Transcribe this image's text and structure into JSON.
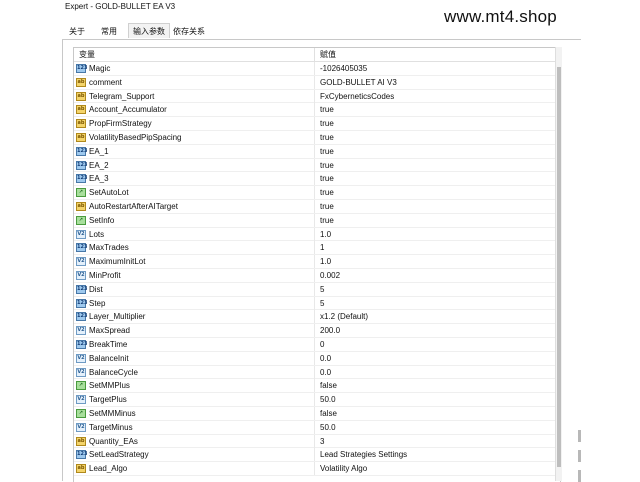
{
  "window": {
    "title": "Expert - GOLD-BULLET EA V3"
  },
  "watermark": "www.mt4.shop",
  "tabs": [
    {
      "label": "关于"
    },
    {
      "label": "常用"
    },
    {
      "label": "输入参数"
    },
    {
      "label": "依存关系"
    }
  ],
  "active_tab": 2,
  "table": {
    "headers": {
      "variable": "变量",
      "value": "赋值"
    },
    "rows": [
      {
        "icon": "ab-string-icon",
        "name": "Magic",
        "value": "-1026405035",
        "type": "n123"
      },
      {
        "icon": "ab-string-icon",
        "name": "comment",
        "value": "GOLD-BULLET AI V3",
        "type": "ab"
      },
      {
        "icon": "ab-string-icon",
        "name": "Telegram_Support",
        "value": "FxCyberneticsCodes",
        "type": "ab"
      },
      {
        "icon": "ab-string-icon",
        "name": "Account_Accumulator",
        "value": "true",
        "type": "ab"
      },
      {
        "icon": "ab-string-icon",
        "name": "PropFirmStrategy",
        "value": "true",
        "type": "ab"
      },
      {
        "icon": "ab-string-icon",
        "name": "VolatilityBasedPipSpacing",
        "value": "true",
        "type": "ab"
      },
      {
        "icon": "integer-icon",
        "name": "EA_1",
        "value": "true",
        "type": "n123"
      },
      {
        "icon": "integer-icon",
        "name": "EA_2",
        "value": "true",
        "type": "n123"
      },
      {
        "icon": "integer-icon",
        "name": "EA_3",
        "value": "true",
        "type": "n123"
      },
      {
        "icon": "graph-icon",
        "name": "SetAutoLot",
        "value": "true",
        "type": "graph"
      },
      {
        "icon": "ab-string-icon",
        "name": "AutoRestartAfterAITarget",
        "value": "true",
        "type": "ab"
      },
      {
        "icon": "graph-icon",
        "name": "SetInfo",
        "value": "true",
        "type": "graph"
      },
      {
        "icon": "double-icon",
        "name": "Lots",
        "value": "1.0",
        "type": "v2"
      },
      {
        "icon": "integer-icon",
        "name": "MaxTrades",
        "value": "1",
        "type": "n123"
      },
      {
        "icon": "double-icon",
        "name": "MaximumInitLot",
        "value": "1.0",
        "type": "v2"
      },
      {
        "icon": "double-icon",
        "name": "MinProfit",
        "value": "0.002",
        "type": "v2"
      },
      {
        "icon": "integer-icon",
        "name": "Dist",
        "value": "5",
        "type": "n123"
      },
      {
        "icon": "integer-icon",
        "name": "Step",
        "value": "5",
        "type": "n123"
      },
      {
        "icon": "integer-icon",
        "name": "Layer_Multiplier",
        "value": "x1.2 (Default)",
        "type": "n123"
      },
      {
        "icon": "double-icon",
        "name": "MaxSpread",
        "value": "200.0",
        "type": "v2"
      },
      {
        "icon": "integer-icon",
        "name": "BreakTime",
        "value": "0",
        "type": "n123"
      },
      {
        "icon": "double-icon",
        "name": "BalanceInit",
        "value": "0.0",
        "type": "v2"
      },
      {
        "icon": "double-icon",
        "name": "BalanceCycle",
        "value": "0.0",
        "type": "v2"
      },
      {
        "icon": "graph-icon",
        "name": "SetMMPlus",
        "value": "false",
        "type": "graph"
      },
      {
        "icon": "double-icon",
        "name": "TargetPlus",
        "value": "50.0",
        "type": "v2"
      },
      {
        "icon": "graph-icon",
        "name": "SetMMMinus",
        "value": "false",
        "type": "graph"
      },
      {
        "icon": "double-icon",
        "name": "TargetMinus",
        "value": "50.0",
        "type": "v2"
      },
      {
        "icon": "ab-string-icon",
        "name": "Quantity_EAs",
        "value": "3",
        "type": "ab"
      },
      {
        "icon": "integer-icon",
        "name": "SetLeadStrategy",
        "value": "Lead Strategies Settings",
        "type": "n123"
      },
      {
        "icon": "ab-string-icon",
        "name": "Lead_Algo",
        "value": "Volatility Algo",
        "type": "ab"
      }
    ]
  },
  "icon_glyphs": {
    "ab": "ab",
    "n123": "123",
    "v2": "V2",
    "graph": "↗"
  }
}
